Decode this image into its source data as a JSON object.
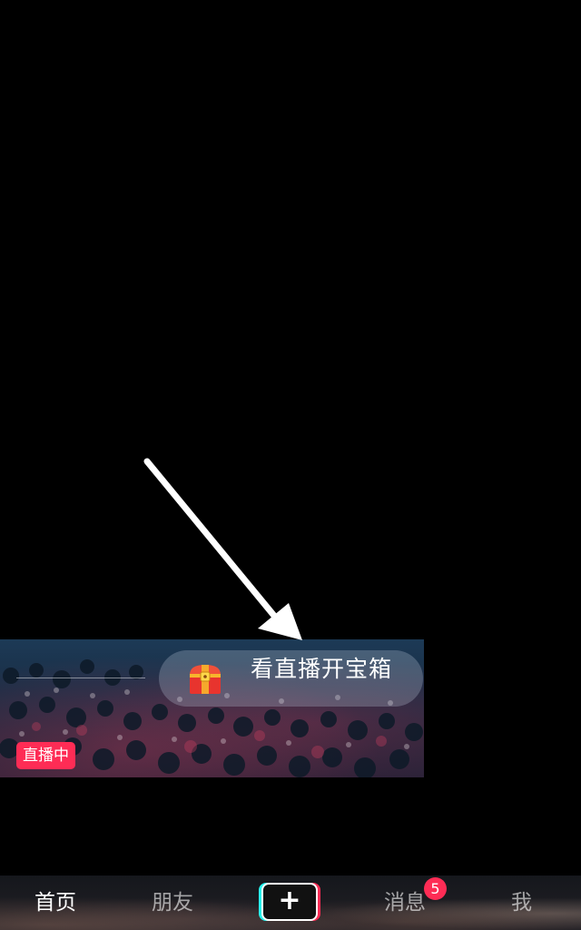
{
  "live_card": {
    "treasure_text": "看直播开宝箱",
    "live_badge": "直播中"
  },
  "tabbar": {
    "home": "首页",
    "friends": "朋友",
    "create": "+",
    "messages": "消息",
    "messages_badge": "5",
    "me": "我"
  },
  "colors": {
    "accent": "#fe2c55",
    "accent_cyan": "#25f4ee",
    "background": "#000000"
  }
}
